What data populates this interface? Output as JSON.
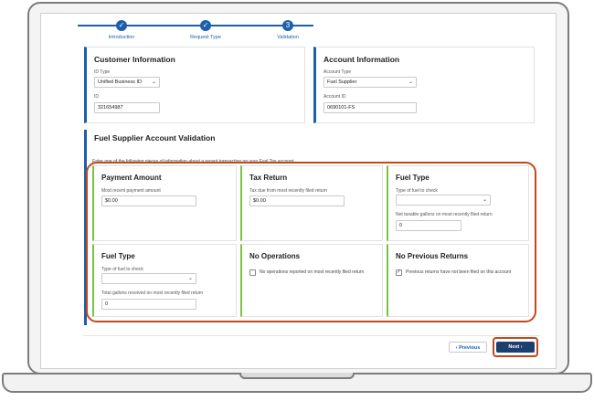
{
  "stepper": {
    "steps": [
      {
        "label": "Introduction",
        "icon": "check-icon",
        "glyph": "✓"
      },
      {
        "label": "Request Type",
        "icon": "check-icon",
        "glyph": "✓"
      },
      {
        "label": "Validation",
        "icon": "current-step-icon",
        "glyph": "3"
      }
    ]
  },
  "customer_info": {
    "title": "Customer Information",
    "id_type_label": "ID Type",
    "id_type_value": "Unified Business ID",
    "id_label": "ID",
    "id_value": "321654987"
  },
  "account_info": {
    "title": "Account Information",
    "account_type_label": "Account Type",
    "account_type_value": "Fuel Supplier",
    "account_id_label": "Account ID",
    "account_id_value": "0690101-FS"
  },
  "validation": {
    "title": "Fuel Supplier Account Validation",
    "description": "Enter one of the following pieces of information about a recent transaction on your Fuel Tax account.",
    "payment_amount": {
      "title": "Payment Amount",
      "label": "Most recent payment amount",
      "value": "$0.00"
    },
    "tax_return": {
      "title": "Tax Return",
      "label": "Tax due from most recently filed return",
      "value": "$0.00"
    },
    "fuel_type_1": {
      "title": "Fuel Type",
      "label": "Type of fuel to check",
      "value": "",
      "gallons_label": "Net taxable gallons on most recently filed return",
      "gallons_value": "0"
    },
    "fuel_type_2": {
      "title": "Fuel Type",
      "label": "Type of fuel to check",
      "value": "",
      "gallons_label": "Total gallons received on most recently filed return",
      "gallons_value": "0"
    },
    "no_operations": {
      "title": "No Operations",
      "checkbox_label": "No operations reported on most recently filed return",
      "checked": false
    },
    "no_previous_returns": {
      "title": "No Previous Returns",
      "checkbox_label": "Previous returns have not been filed on this account",
      "checked": true
    }
  },
  "footer": {
    "previous_label": "Previous",
    "next_label": "Next",
    "previous_icon": "chevron-left-icon",
    "next_icon": "chevron-right-icon"
  },
  "colors": {
    "primary": "#1d5fa8",
    "option_accent": "#7cc142",
    "highlight": "#c4471b",
    "next_button": "#1d3f6e"
  }
}
